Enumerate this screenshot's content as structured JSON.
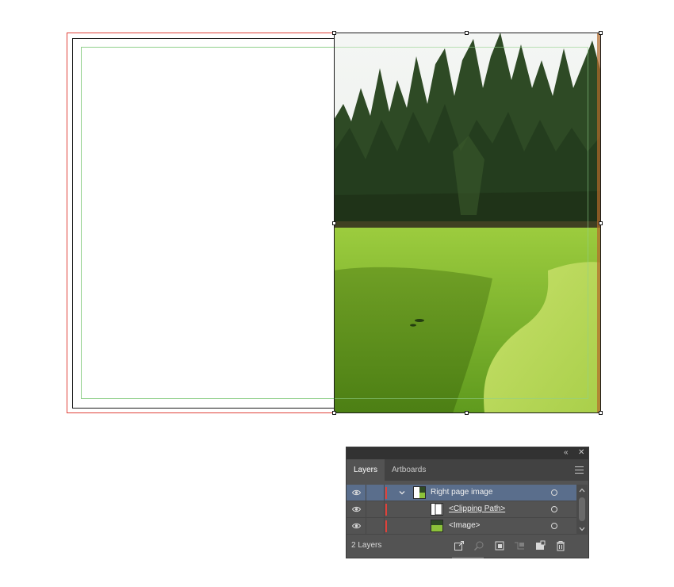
{
  "colors": {
    "bleed": "#e0413a",
    "trim": "#1a1a1a",
    "margin_guide": "#8fd08a",
    "panel_bg": "#535353",
    "panel_selected_row": "#5a6e8c",
    "layer_color": "#e0413a"
  },
  "layers_panel": {
    "collapse_icon": "double-chevron-left-icon",
    "close_icon": "close-icon",
    "tabs": [
      {
        "label": "Layers",
        "active": true
      },
      {
        "label": "Artboards",
        "active": false
      }
    ],
    "menu_icon": "hamburger-menu-icon",
    "rows": [
      {
        "label": "Right page image",
        "selected": true,
        "expanded": true,
        "thumbnail": "image-thumbnail"
      },
      {
        "label": "<Clipping Path>",
        "selected": false,
        "thumbnail": "blank-rect-thumbnail"
      },
      {
        "label": "<Image>",
        "selected": false,
        "thumbnail": "photo-thumbnail"
      }
    ],
    "footer": {
      "count_label": "2 Layers",
      "icons": [
        "export-icon",
        "locate-object-icon",
        "make-clipping-mask-icon",
        "new-sublayer-icon",
        "new-layer-icon",
        "delete-icon"
      ]
    }
  }
}
